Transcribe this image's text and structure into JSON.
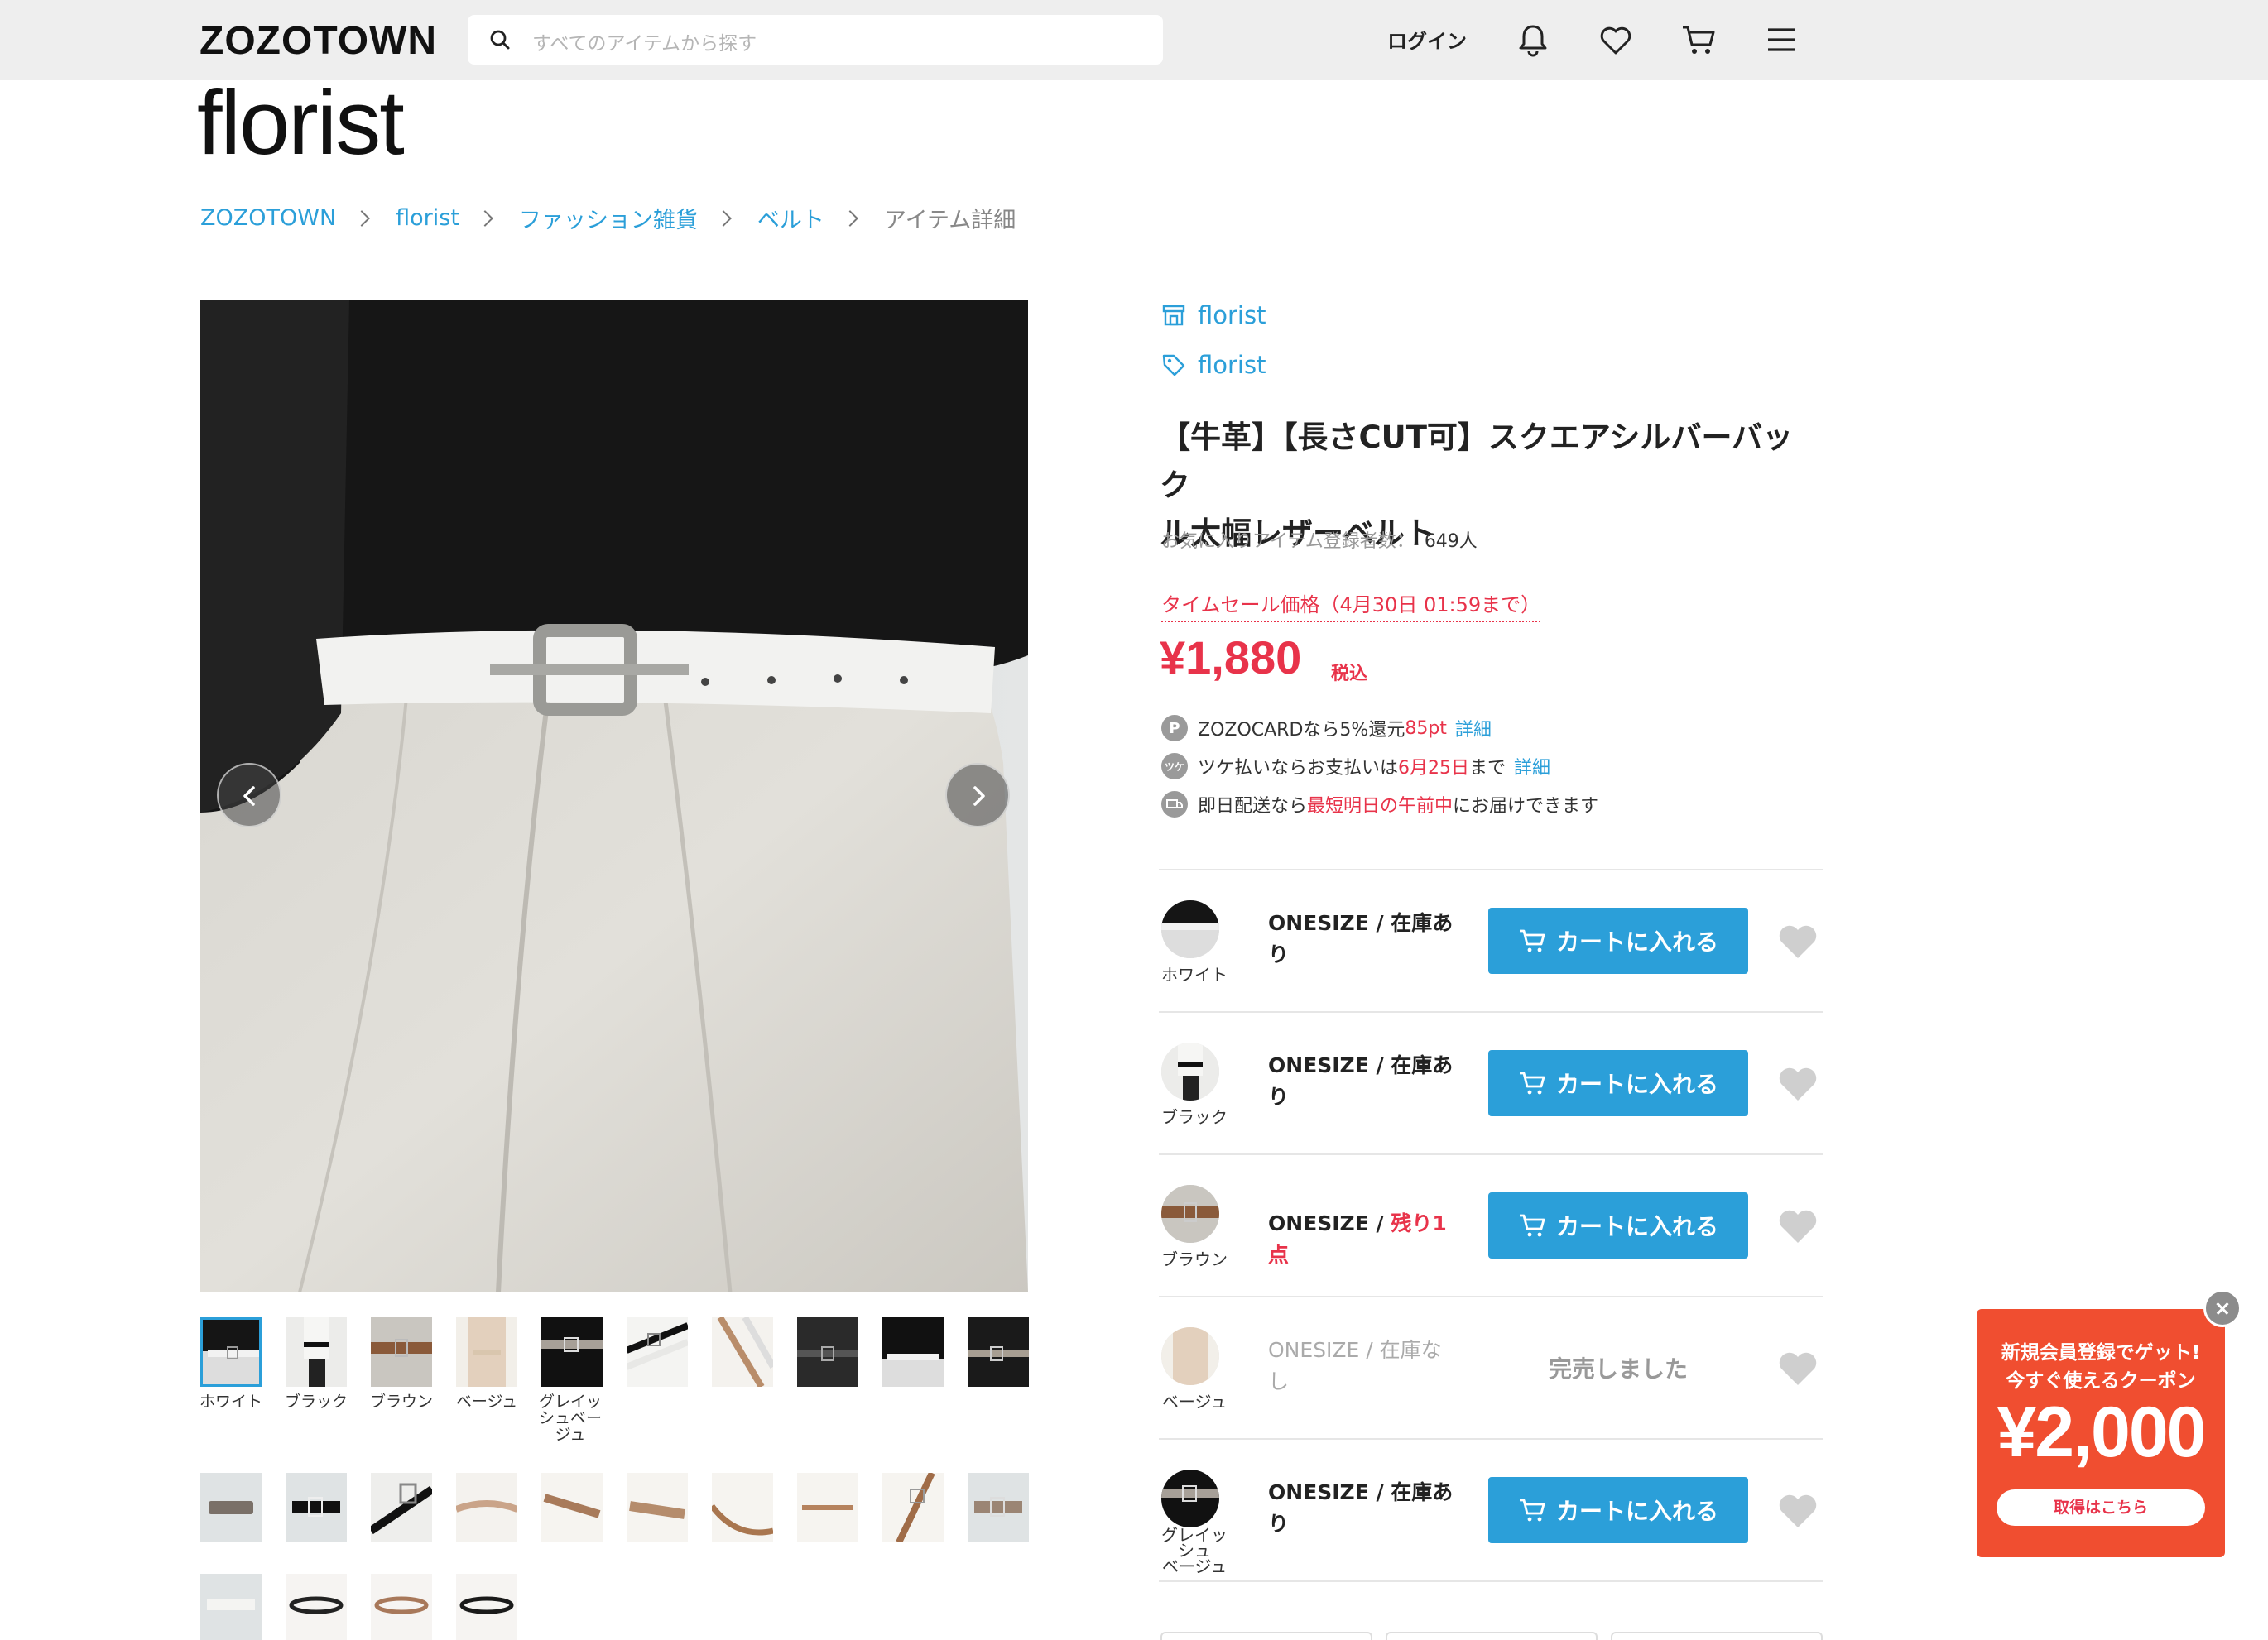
{
  "header": {
    "logo": "ZOZOTOWN",
    "search_placeholder": "すべてのアイテムから探す",
    "login": "ログイン",
    "icons": [
      "bell-icon",
      "heart-icon",
      "cart-icon",
      "menu-icon"
    ]
  },
  "brand": {
    "logo": "florist"
  },
  "breadcrumb": [
    "ZOZOTOWN",
    "florist",
    "ファッション雑貨",
    "ベルト",
    "アイテム詳細"
  ],
  "gallery": {
    "thumb_labels": [
      "ホワイト",
      "ブラック",
      "ブラウン",
      "ベージュ",
      "グレイッシュベージュ"
    ]
  },
  "product": {
    "shop": "florist",
    "brand": "florist",
    "title_line1": "【牛革】【長さCUT可】スクエアシルバーバック",
    "title_line2": "ル太幅レザーベルト",
    "fav_label": "お気に入りアイテム登録者数：",
    "fav_count": "649人",
    "sale_label": "タイムセール価格（4月30日 01:59まで）",
    "price": "¥1,880",
    "tax": "税込",
    "points": {
      "icon": "P",
      "text": "ZOZOCARDなら5%還元",
      "pts": "85pt",
      "link": "詳細"
    },
    "tsuke": {
      "icon": "ツケ",
      "text": "ツケ払いならお支払いは",
      "date": "6月25日",
      "text2": "まで",
      "link": "詳細"
    },
    "delivery": {
      "text": "即日配送なら",
      "red": "最短明日の午前中",
      "text2": "にお届けできます"
    }
  },
  "variants": [
    {
      "color": "ホワイト",
      "size": "ONESIZE / 在庫あ",
      "size2": "り",
      "status": "in",
      "button": "カートに入れる"
    },
    {
      "color": "ブラック",
      "size": "ONESIZE / 在庫あ",
      "size2": "り",
      "status": "in",
      "button": "カートに入れる"
    },
    {
      "color": "ブラウン",
      "size": "ONESIZE / ",
      "size_red": "残り1点",
      "status": "in",
      "button": "カートに入れる"
    },
    {
      "color": "ベージュ",
      "size": "ONESIZE / 在庫な",
      "size2": "し",
      "status": "sold",
      "button": "完売しました"
    },
    {
      "color": "グレイッシュベージュ",
      "color_l1": "グレイッシュ",
      "color_l2": "ベージュ",
      "size": "ONESIZE / 在庫あ",
      "size2": "り",
      "status": "in",
      "button": "カートに入れる"
    }
  ],
  "coupon": {
    "line1": "新規会員登録でゲット!",
    "line2": "今すぐ使えるクーポン",
    "amount": "¥2,000",
    "button": "取得はこちら"
  },
  "colors": {
    "accent": "#2b9fd9",
    "sale": "#e8334a",
    "coupon": "#f04e30",
    "header_bg": "#eeeeee"
  }
}
